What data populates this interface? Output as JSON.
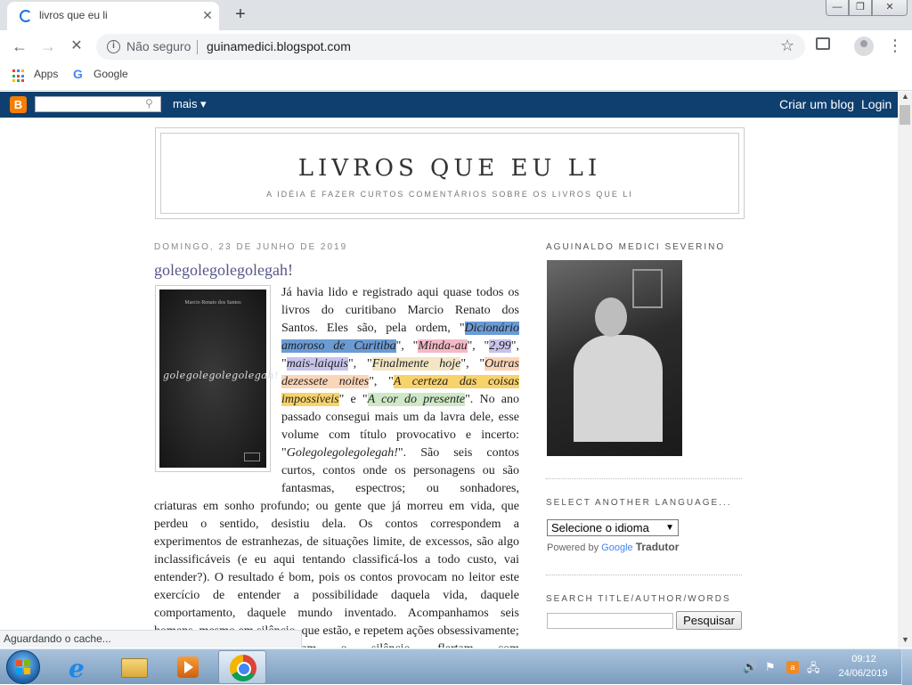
{
  "browser": {
    "tab_title": "livros que eu li",
    "tab_close": "✕",
    "new_tab": "+",
    "win_min": "—",
    "win_max": "❐",
    "win_close": "✕",
    "back": "←",
    "forward": "→",
    "reload": "✕",
    "security_icon": "i",
    "security_text": "Não seguro",
    "url": "guinamedici.blogspot.com",
    "star": "☆",
    "menu": "⋮",
    "status": "Aguardando o cache...",
    "icons": [
      "loading-spinner-icon",
      "info-icon",
      "star-icon",
      "extension-icon",
      "profile-icon",
      "menu-icon",
      "apps-icon",
      "google-icon"
    ]
  },
  "bookmarks": [
    {
      "label": "Apps"
    },
    {
      "label": "Google"
    }
  ],
  "navbar": {
    "logo": "B",
    "search_icon": "⚲",
    "more": "mais ▾",
    "create_blog": "Criar um blog",
    "login": "Login"
  },
  "blog": {
    "title": "LIVROS QUE EU LI",
    "description": "A IDÉIA É FAZER CURTOS COMENTÁRIOS SOBRE OS LIVROS QUE LI"
  },
  "post": {
    "date": "DOMINGO, 23 DE JUNHO DE 2019",
    "title": "golegolegolegolegah!",
    "cover_author": "Marcio Renato dos Santos",
    "cover_title": "golegolegolegolegah!",
    "lines": [
      "Já havia lido e registrado aqui quase todos os",
      "livros do curitibano Marcio Renato dos",
      "Santos. Eles são, pela ordem, \"",
      "Dicionário",
      "amoroso de Curitiba",
      "\", \"",
      "Minda-au",
      "\", \"",
      "2,99",
      "\",",
      "\"",
      "mais-laiquis",
      "\", \"",
      "Finalmente hoje",
      "\", \"",
      "Outras",
      "dezessete noites",
      "\", \"",
      "A certeza das coisas",
      "impossíveis",
      "\" e \"",
      "A cor do presente",
      "\". No ano",
      "passado consegui mais um da lavra dele, esse",
      "volume com título provocativo e incerto:",
      "\"",
      "Golegolegolegolegah!",
      "\". São seis contos",
      "curtos, contos onde os personagens ou são",
      "fantasmas, espectros; ou sonhadores,",
      "criaturas em sonho profundo; ou gente que já morreu em vida, que",
      "perdeu o sentido, desistiu dela. Os contos correspondem a",
      "experimentos de estranhezas, de situações limite, de excessos, são algo",
      "inclassificáveis (e eu aqui tentando classificá-los a todo custo, vai",
      "entender?). O resultado é bom, pois os contos provocam no leitor este",
      "exercício de entender a possibilidade daquela vida, daquele",
      "comportamento, daquele mundo inventado. Acompanhamos seis",
      "homens, mesmo em silêncio, que estão, e repetem ações obsessivamente; vagam",
      "sem propósito, cultivam o silêncio, flertam com"
    ]
  },
  "sidebar": {
    "profile_heading": "AGUINALDO MEDICI SEVERINO",
    "language_heading": "SELECT ANOTHER LANGUAGE...",
    "language_select": "Selecione o idioma",
    "select_arrow": "▼",
    "powered_by": "Powered by",
    "powered_google": "Google",
    "powered_translate": "Tradutor",
    "search_heading": "SEARCH TITLE/AUTHOR/WORDS",
    "search_button": "Pesquisar"
  },
  "taskbar": {
    "ie_glyph": "e",
    "tray_volume": "🔊",
    "tray_flag": "⚑",
    "tray_app": "a",
    "tray_net": "🖧",
    "time": "09:12",
    "date": "24/06/2019"
  },
  "colors": {
    "navbar": "#0e3f6f",
    "blogger_orange": "#f57d00",
    "post_title": "#555588",
    "highlight_blue": "#6b9bd4",
    "highlight_pink": "#f4b8c6",
    "highlight_purple": "#c8c3ea",
    "highlight_yellow": "#f8d36b",
    "highlight_green": "#cfe8c8"
  }
}
